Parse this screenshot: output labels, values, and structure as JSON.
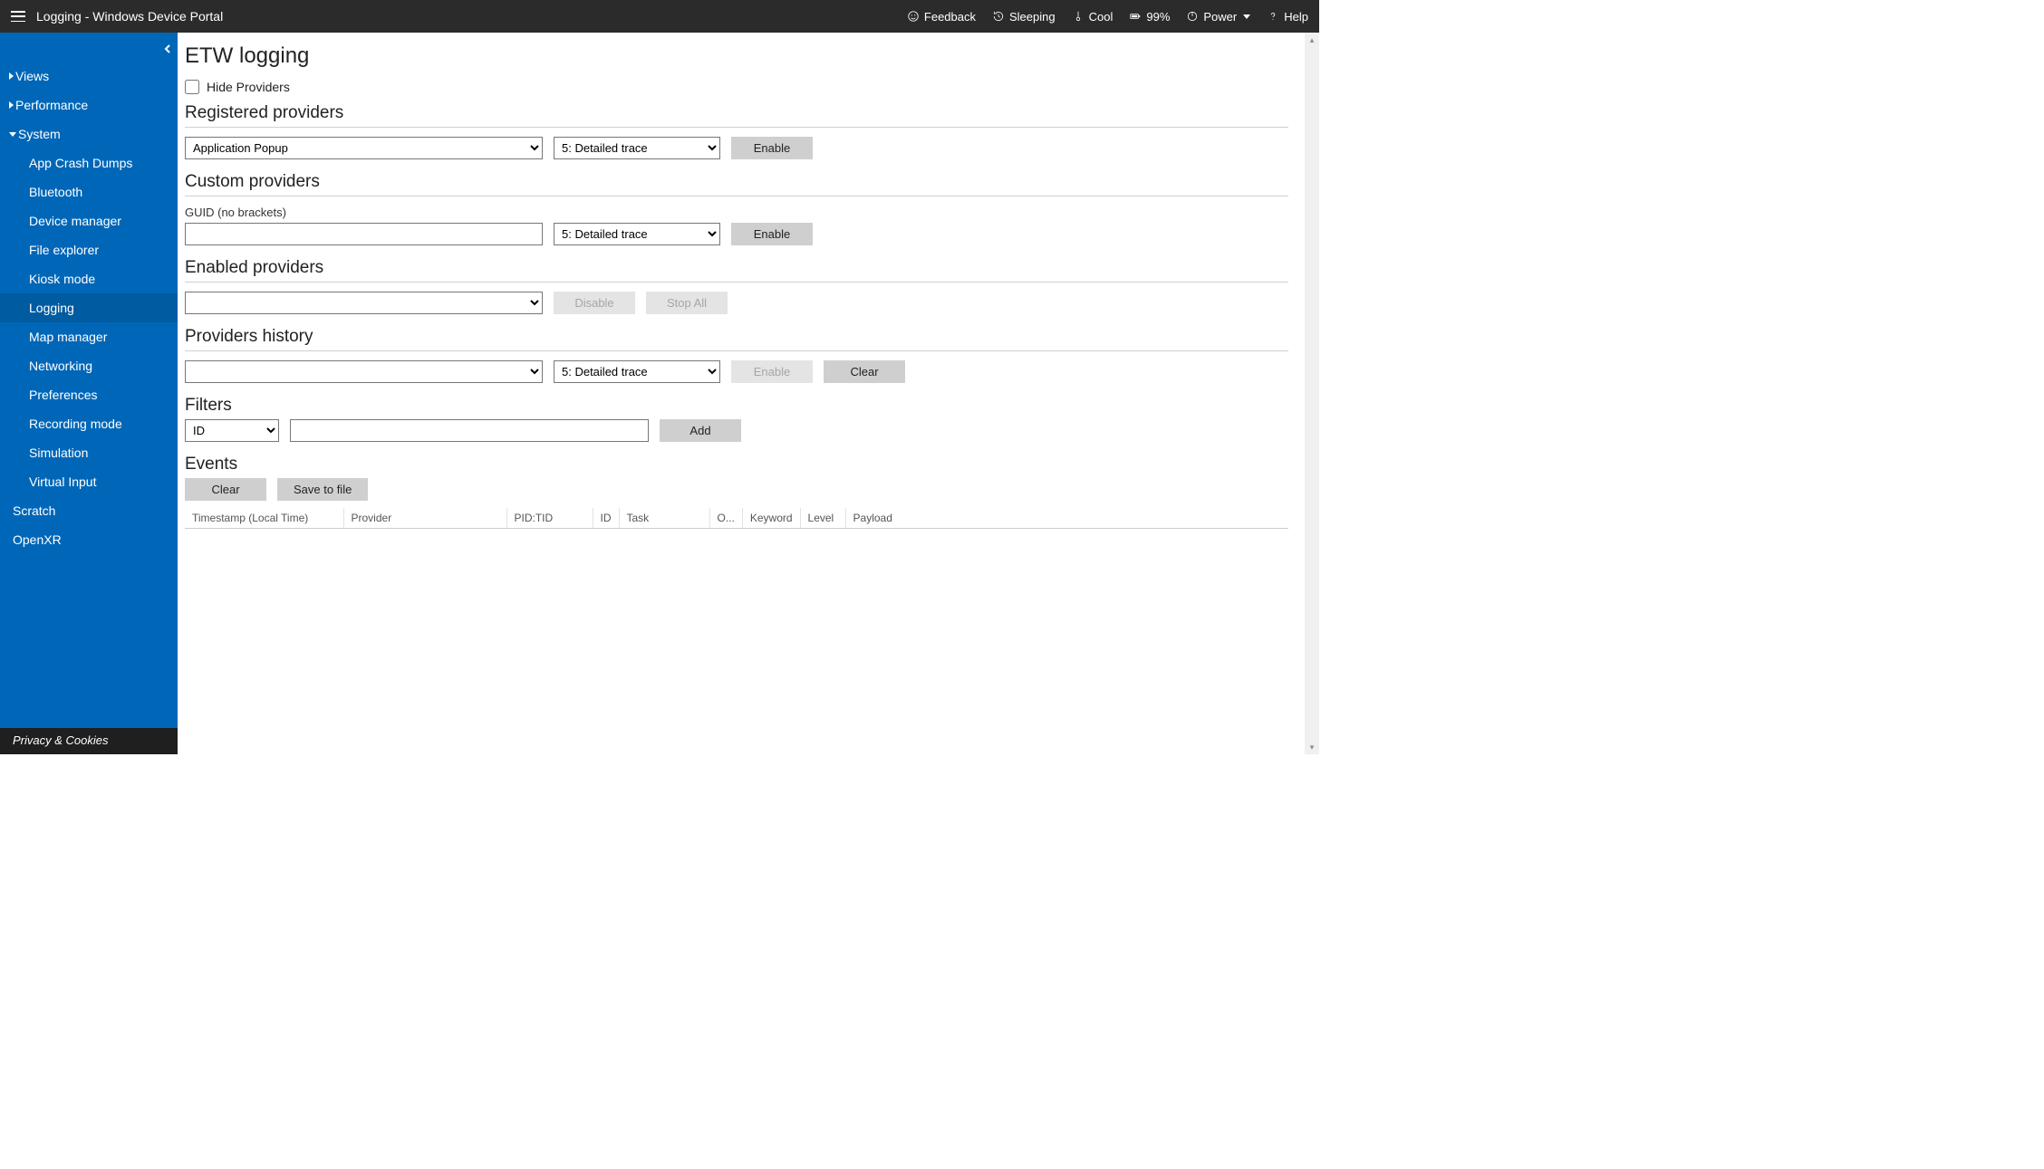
{
  "topbar": {
    "title": "Logging - Windows Device Portal",
    "feedback": "Feedback",
    "sleep_state": "Sleeping",
    "temp_state": "Cool",
    "battery": "99%",
    "power": "Power",
    "help": "Help"
  },
  "sidebar": {
    "groups": [
      {
        "label": "Views",
        "expanded": false
      },
      {
        "label": "Performance",
        "expanded": false
      },
      {
        "label": "System",
        "expanded": true
      }
    ],
    "system_children": [
      "App Crash Dumps",
      "Bluetooth",
      "Device manager",
      "File explorer",
      "Kiosk mode",
      "Logging",
      "Map manager",
      "Networking",
      "Preferences",
      "Recording mode",
      "Simulation",
      "Virtual Input"
    ],
    "active_child": "Logging",
    "plain": [
      "Scratch",
      "OpenXR"
    ],
    "footer": "Privacy & Cookies"
  },
  "page": {
    "title": "ETW logging",
    "hide_providers_label": "Hide Providers",
    "hide_providers_checked": false,
    "registered": {
      "heading": "Registered providers",
      "provider_selected": "Application Popup",
      "level_selected": "5: Detailed trace",
      "enable": "Enable"
    },
    "custom": {
      "heading": "Custom providers",
      "hint": "GUID (no brackets)",
      "guid_value": "",
      "level_selected": "5: Detailed trace",
      "enable": "Enable"
    },
    "enabled": {
      "heading": "Enabled providers",
      "selected": "",
      "disable": "Disable",
      "stop_all": "Stop All"
    },
    "history": {
      "heading": "Providers history",
      "selected": "",
      "level_selected": "5: Detailed trace",
      "enable": "Enable",
      "clear": "Clear"
    },
    "filters": {
      "heading": "Filters",
      "field_selected": "ID",
      "value": "",
      "add": "Add"
    },
    "events": {
      "heading": "Events",
      "clear": "Clear",
      "save": "Save to file",
      "columns": [
        "Timestamp (Local Time)",
        "Provider",
        "PID:TID",
        "ID",
        "Task",
        "O...",
        "Keyword",
        "Level",
        "Payload"
      ]
    }
  }
}
